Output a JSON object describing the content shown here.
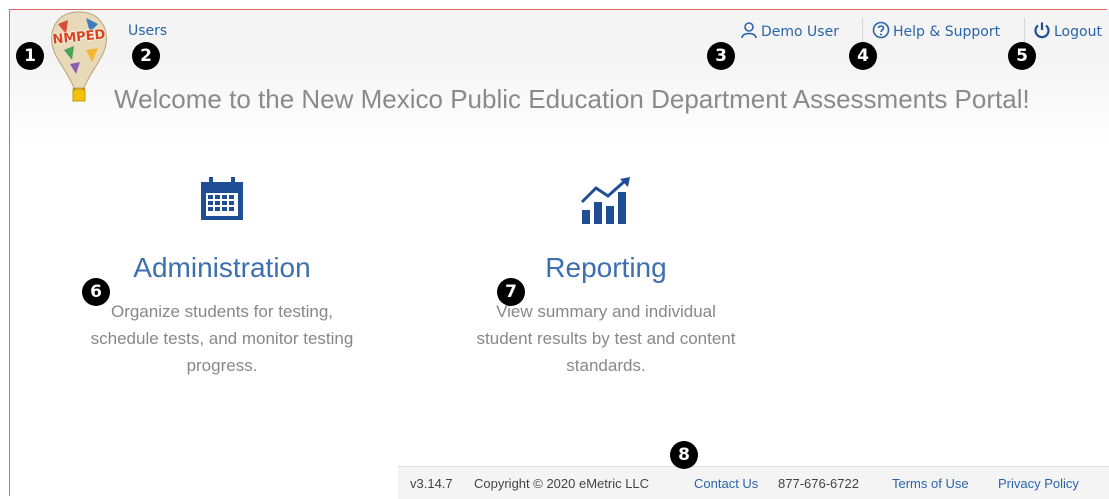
{
  "header": {
    "logo_text": "NMPED",
    "users_link": "Users",
    "user_name": "Demo User",
    "help_label": "Help & Support",
    "logout_label": "Logout"
  },
  "welcome": {
    "text": "Welcome to the New Mexico Public Education Department Assessments Portal!"
  },
  "tiles": [
    {
      "title": "Administration",
      "description_lines": [
        "Organize students for testing,",
        "schedule tests, and monitor testing",
        "progress."
      ],
      "icon": "calendar-icon"
    },
    {
      "title": "Reporting",
      "description_lines": [
        "View summary and individual",
        "student results by test and content",
        "standards."
      ],
      "icon": "bar-chart-icon"
    }
  ],
  "footer": {
    "version": "v3.14.7",
    "copyright": "Copyright © 2020 eMetric LLC",
    "contact_label": "Contact Us",
    "phone": "877-676-6722",
    "terms_label": "Terms of Use",
    "privacy_label": "Privacy Policy"
  },
  "callouts": [
    "1",
    "2",
    "3",
    "4",
    "5",
    "6",
    "7",
    "8"
  ],
  "colors": {
    "link": "#2a64a8",
    "tile_title": "#3d6fae",
    "icon": "#1f4e96",
    "callout": "#000000"
  }
}
